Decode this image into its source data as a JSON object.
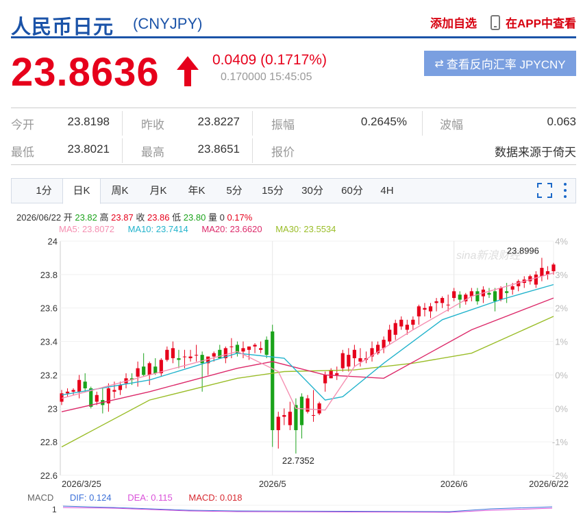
{
  "header": {
    "title": "人民币日元",
    "code": "(CNYJPY)",
    "add_watchlist": "添加自选",
    "view_in_app": "在APP中查看"
  },
  "quote": {
    "price": "23.8636",
    "change": "0.0409 (0.1717%)",
    "time": "0.170000 15:45:05",
    "reverse_label": "查看反向汇率 JPYCNY"
  },
  "stats": {
    "row1": [
      {
        "label": "今开",
        "value": "23.8198"
      },
      {
        "label": "昨收",
        "value": "23.8227"
      },
      {
        "label": "振幅",
        "value": "0.2645%"
      },
      {
        "label": "波幅",
        "value": "0.063"
      }
    ],
    "row2": [
      {
        "label": "最低",
        "value": "23.8021"
      },
      {
        "label": "最高",
        "value": "23.8651"
      },
      {
        "label": "报价",
        "value": "数据来源于倚天"
      }
    ]
  },
  "tabs": [
    "1分",
    "日K",
    "周K",
    "月K",
    "年K",
    "5分",
    "15分",
    "30分",
    "60分",
    "4H"
  ],
  "active_tab": 1,
  "ohlc_info": {
    "date": "2026/06/22",
    "open_label": "开",
    "open": "23.82",
    "high_label": "高",
    "high": "23.87",
    "close_label": "收",
    "close": "23.86",
    "low_label": "低",
    "low": "23.80",
    "vol_label": "量",
    "vol": "0",
    "pct": "0.17%"
  },
  "ma_info": {
    "ma5": "MA5: 23.8072",
    "ma10": "MA10: 23.7414",
    "ma20": "MA20: 23.6620",
    "ma30": "MA30: 23.5534"
  },
  "macd_info": {
    "label": "MACD",
    "dif": "DIF: 0.124",
    "dea": "DEA: 0.115",
    "macd": "MACD: 0.018",
    "axis_top": "1"
  },
  "colors": {
    "up": "#e6001b",
    "down": "#1ba31b",
    "ma5": "#f58fb1",
    "ma10": "#22b3cc",
    "ma20": "#dc2a6a",
    "ma30": "#9abd28",
    "brand": "#1b53a8"
  },
  "chart_data": {
    "type": "candlestick",
    "y_ticks": [
      "24",
      "23.8",
      "23.6",
      "23.4",
      "23.2",
      "23",
      "22.8",
      "22.6"
    ],
    "ylim": [
      22.6,
      24.0
    ],
    "pct_ticks": [
      "4%",
      "3%",
      "2%",
      "1%",
      "0%",
      "0%",
      "-1%",
      "-2%"
    ],
    "x_ticks": [
      "2026/3/25",
      "2026/5",
      "2026/6",
      "2026/6/22"
    ],
    "annotations": {
      "max": "23.8996",
      "min": "22.7352"
    },
    "watermark": "sina新浪财经",
    "candles": [
      [
        23.04,
        23.11,
        23.02,
        23.09
      ],
      [
        23.09,
        23.12,
        23.07,
        23.1
      ],
      [
        23.1,
        23.12,
        23.08,
        23.11
      ],
      [
        23.1,
        23.2,
        23.06,
        23.17
      ],
      [
        23.16,
        23.21,
        23.1,
        23.12
      ],
      [
        23.12,
        23.13,
        23.0,
        23.01
      ],
      [
        23.04,
        23.1,
        23.02,
        23.08
      ],
      [
        23.05,
        23.12,
        22.97,
        23.02
      ],
      [
        23.03,
        23.15,
        22.98,
        23.12
      ],
      [
        23.1,
        23.16,
        23.06,
        23.11
      ],
      [
        23.11,
        23.16,
        23.08,
        23.14
      ],
      [
        23.15,
        23.21,
        23.12,
        23.18
      ],
      [
        23.18,
        23.21,
        23.14,
        23.17
      ],
      [
        23.19,
        23.28,
        23.13,
        23.24
      ],
      [
        23.25,
        23.33,
        23.19,
        23.2
      ],
      [
        23.2,
        23.28,
        23.14,
        23.27
      ],
      [
        23.25,
        23.3,
        23.2,
        23.21
      ],
      [
        23.21,
        23.3,
        23.19,
        23.29
      ],
      [
        23.29,
        23.37,
        23.28,
        23.35
      ],
      [
        23.3,
        23.4,
        23.27,
        23.36
      ],
      [
        23.3,
        23.35,
        23.24,
        23.29
      ],
      [
        23.31,
        23.35,
        23.24,
        23.31
      ],
      [
        23.3,
        23.35,
        23.28,
        23.31
      ],
      [
        23.32,
        23.38,
        23.28,
        23.32
      ],
      [
        23.32,
        23.34,
        23.1,
        23.27
      ],
      [
        23.27,
        23.31,
        23.2,
        23.31
      ],
      [
        23.31,
        23.34,
        23.28,
        23.33
      ],
      [
        23.35,
        23.38,
        23.3,
        23.3
      ],
      [
        23.3,
        23.37,
        23.27,
        23.36
      ],
      [
        23.37,
        23.42,
        23.3,
        23.37
      ],
      [
        23.38,
        23.4,
        23.31,
        23.33
      ],
      [
        23.34,
        23.4,
        23.3,
        23.36
      ],
      [
        23.35,
        23.37,
        23.29,
        23.37
      ],
      [
        23.37,
        23.39,
        23.33,
        23.38
      ],
      [
        23.35,
        23.4,
        23.33,
        23.36
      ],
      [
        23.41,
        23.43,
        23.3,
        23.32
      ],
      [
        23.46,
        23.5,
        22.77,
        22.87
      ],
      [
        22.87,
        22.98,
        22.76,
        22.95
      ],
      [
        22.95,
        23.0,
        22.9,
        22.96
      ],
      [
        22.9,
        23.04,
        22.87,
        22.98
      ],
      [
        23.02,
        23.06,
        22.73,
        22.87
      ],
      [
        23.07,
        23.09,
        22.82,
        22.9
      ],
      [
        22.98,
        23.08,
        22.97,
        23.06
      ],
      [
        22.96,
        23.11,
        22.92,
        22.96
      ],
      [
        22.97,
        23.04,
        22.96,
        23.03
      ],
      [
        23.15,
        23.22,
        23.1,
        23.2
      ],
      [
        23.18,
        23.24,
        23.18,
        23.23
      ],
      [
        23.2,
        23.25,
        23.17,
        23.21
      ],
      [
        23.24,
        23.35,
        23.22,
        23.33
      ],
      [
        23.25,
        23.36,
        23.22,
        23.32
      ],
      [
        23.3,
        23.38,
        23.25,
        23.35
      ],
      [
        23.28,
        23.36,
        23.25,
        23.3
      ],
      [
        23.29,
        23.34,
        23.27,
        23.3
      ],
      [
        23.31,
        23.4,
        23.28,
        23.36
      ],
      [
        23.33,
        23.4,
        23.32,
        23.38
      ],
      [
        23.36,
        23.43,
        23.33,
        23.41
      ],
      [
        23.4,
        23.5,
        23.38,
        23.47
      ],
      [
        23.44,
        23.53,
        23.41,
        23.51
      ],
      [
        23.49,
        23.55,
        23.47,
        23.53
      ],
      [
        23.47,
        23.53,
        23.44,
        23.5
      ],
      [
        23.5,
        23.55,
        23.47,
        23.53
      ],
      [
        23.55,
        23.62,
        23.5,
        23.61
      ],
      [
        23.59,
        23.63,
        23.55,
        23.6
      ],
      [
        23.58,
        23.63,
        23.54,
        23.61
      ],
      [
        23.63,
        23.66,
        23.58,
        23.64
      ],
      [
        23.63,
        23.67,
        23.6,
        23.66
      ],
      [
        23.62,
        23.68,
        23.58,
        23.62
      ],
      [
        23.66,
        23.72,
        23.64,
        23.7
      ],
      [
        23.68,
        23.7,
        23.6,
        23.65
      ],
      [
        23.64,
        23.69,
        23.62,
        23.68
      ],
      [
        23.67,
        23.72,
        23.64,
        23.7
      ],
      [
        23.7,
        23.72,
        23.62,
        23.64
      ],
      [
        23.67,
        23.73,
        23.63,
        23.71
      ],
      [
        23.69,
        23.72,
        23.66,
        23.68
      ],
      [
        23.7,
        23.72,
        23.58,
        23.64
      ],
      [
        23.65,
        23.73,
        23.64,
        23.72
      ],
      [
        23.7,
        23.75,
        23.63,
        23.69
      ],
      [
        23.71,
        23.75,
        23.68,
        23.73
      ],
      [
        23.73,
        23.77,
        23.7,
        23.76
      ],
      [
        23.75,
        23.79,
        23.72,
        23.77
      ],
      [
        23.76,
        23.8,
        23.74,
        23.79
      ],
      [
        23.74,
        23.82,
        23.72,
        23.8
      ],
      [
        23.79,
        23.9,
        23.76,
        23.84
      ],
      [
        23.8,
        23.85,
        23.77,
        23.82
      ],
      [
        23.82,
        23.87,
        23.8,
        23.86
      ]
    ],
    "ma5": [
      [
        0,
        23.06
      ],
      [
        15,
        23.2
      ],
      [
        30,
        23.34
      ],
      [
        37,
        23.22
      ],
      [
        40,
        23.0
      ],
      [
        45,
        22.99
      ],
      [
        50,
        23.25
      ],
      [
        60,
        23.47
      ],
      [
        70,
        23.67
      ],
      [
        84,
        23.81
      ]
    ],
    "ma10": [
      [
        0,
        23.08
      ],
      [
        15,
        23.17
      ],
      [
        30,
        23.33
      ],
      [
        38,
        23.3
      ],
      [
        45,
        23.05
      ],
      [
        48,
        23.07
      ],
      [
        55,
        23.27
      ],
      [
        65,
        23.53
      ],
      [
        75,
        23.65
      ],
      [
        84,
        23.74
      ]
    ],
    "ma20": [
      [
        0,
        22.98
      ],
      [
        15,
        23.1
      ],
      [
        30,
        23.24
      ],
      [
        36,
        23.28
      ],
      [
        45,
        23.2
      ],
      [
        55,
        23.18
      ],
      [
        70,
        23.47
      ],
      [
        84,
        23.66
      ]
    ],
    "ma30": [
      [
        0,
        22.77
      ],
      [
        15,
        23.05
      ],
      [
        30,
        23.18
      ],
      [
        38,
        23.22
      ],
      [
        50,
        23.23
      ],
      [
        60,
        23.27
      ],
      [
        70,
        23.33
      ],
      [
        84,
        23.55
      ]
    ]
  }
}
